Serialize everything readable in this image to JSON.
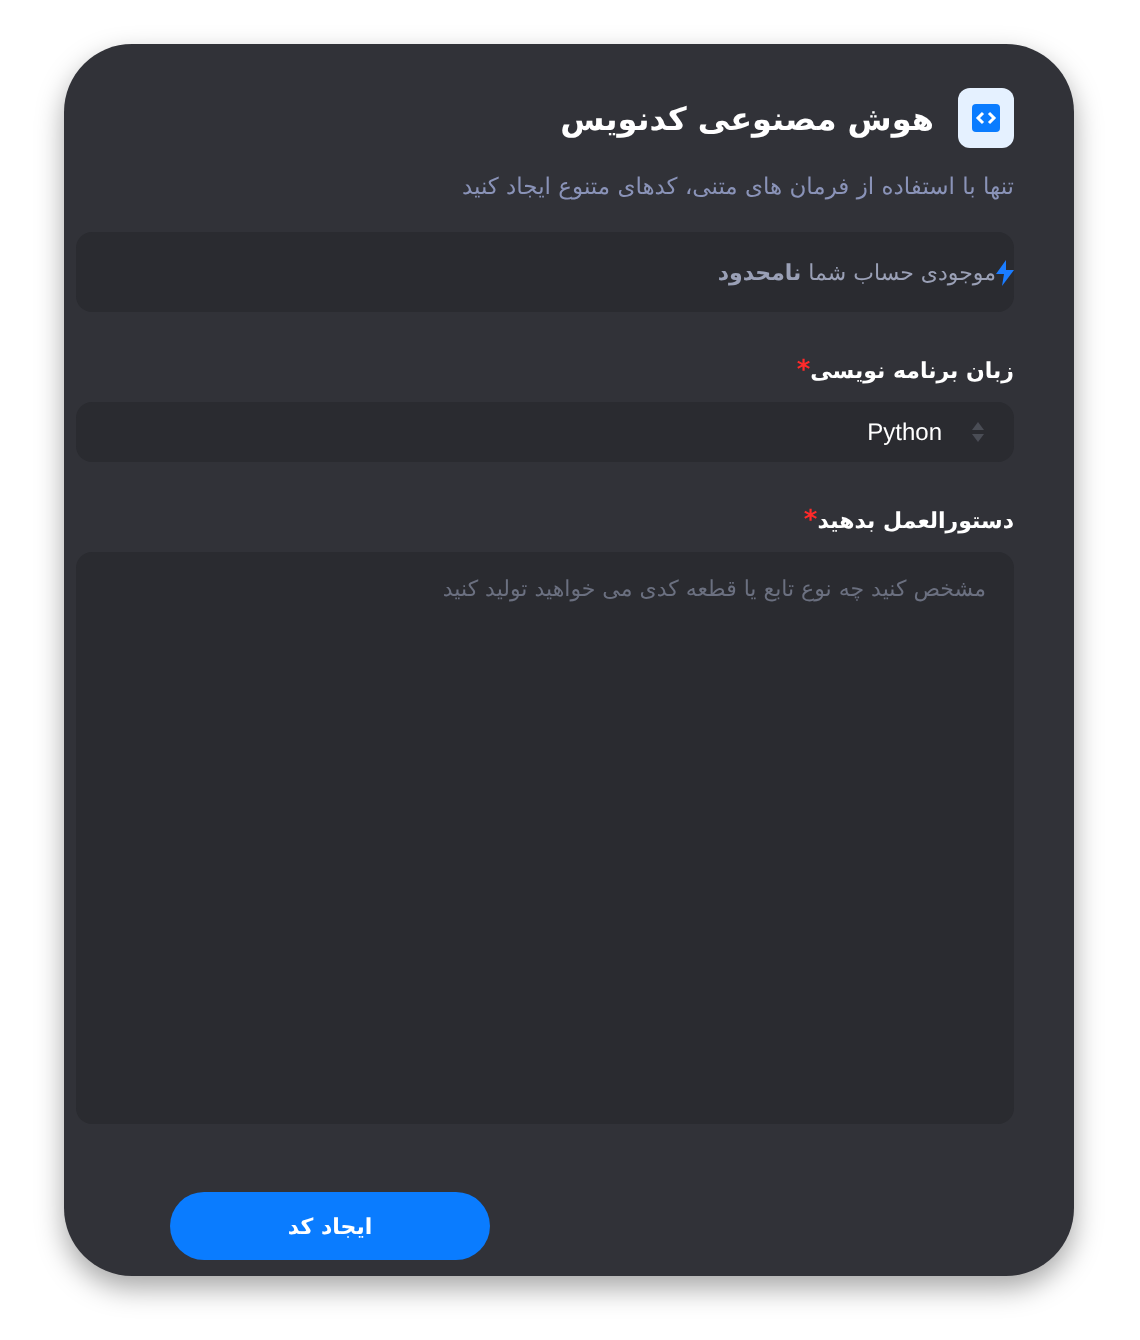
{
  "header": {
    "title": "هوش مصنوعی کدنویس",
    "subtitle": "تنها با استفاده از فرمان های متنی، کدهای متنوع ایجاد کنید"
  },
  "balance": {
    "text": "موجودی حساب شما **نامحدود**"
  },
  "fields": [
    {
      "kind": "select",
      "label": "زبان برنامه نویسی",
      "required_mark": "*",
      "value": "Python"
    },
    {
      "kind": "textarea",
      "label": "دستورالعمل بدهید",
      "required_mark": "*",
      "placeholder": "مشخص کنید چه نوع تابع یا قطعه کدی می خواهید تولید کنید"
    }
  ],
  "submit": {
    "label": "ایجاد کد"
  }
}
